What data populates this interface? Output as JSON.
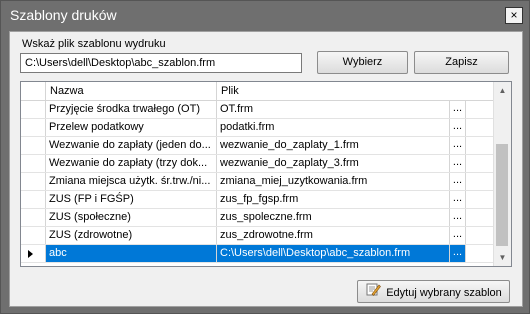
{
  "window": {
    "title": "Szablony druków",
    "close_icon": "×"
  },
  "form": {
    "label": "Wskaż plik szablonu wydruku",
    "path_value": "C:\\Users\\dell\\Desktop\\abc_szablon.frm",
    "select_label": "Wybierz",
    "save_label": "Zapisz"
  },
  "grid": {
    "columns": [
      "Nazwa",
      "Plik"
    ],
    "ellipsis": "...",
    "rows": [
      {
        "name": "Przyjęcie środka trwałego (OT)",
        "file": "OT.frm"
      },
      {
        "name": "Przelew podatkowy",
        "file": "podatki.frm"
      },
      {
        "name": "Wezwanie do zapłaty (jeden do...",
        "file": "wezwanie_do_zaplaty_1.frm"
      },
      {
        "name": "Wezwanie do zapłaty (trzy dok...",
        "file": "wezwanie_do_zaplaty_3.frm"
      },
      {
        "name": "Zmiana miejsca użytk. śr.trw./ni...",
        "file": "zmiana_miej_uzytkowania.frm"
      },
      {
        "name": "ZUS (FP i FGŚP)",
        "file": "zus_fp_fgsp.frm"
      },
      {
        "name": "ZUS (społeczne)",
        "file": "zus_spoleczne.frm"
      },
      {
        "name": "ZUS (zdrowotne)",
        "file": "zus_zdrowotne.frm"
      },
      {
        "name": "abc",
        "file": "C:\\Users\\dell\\Desktop\\abc_szablon.frm"
      }
    ],
    "active_row_index": 8
  },
  "footer": {
    "edit_label": "Edytuj wybrany szablon",
    "edit_icon": "edit-pencil-icon"
  },
  "colors": {
    "selection": "#0078d7"
  }
}
